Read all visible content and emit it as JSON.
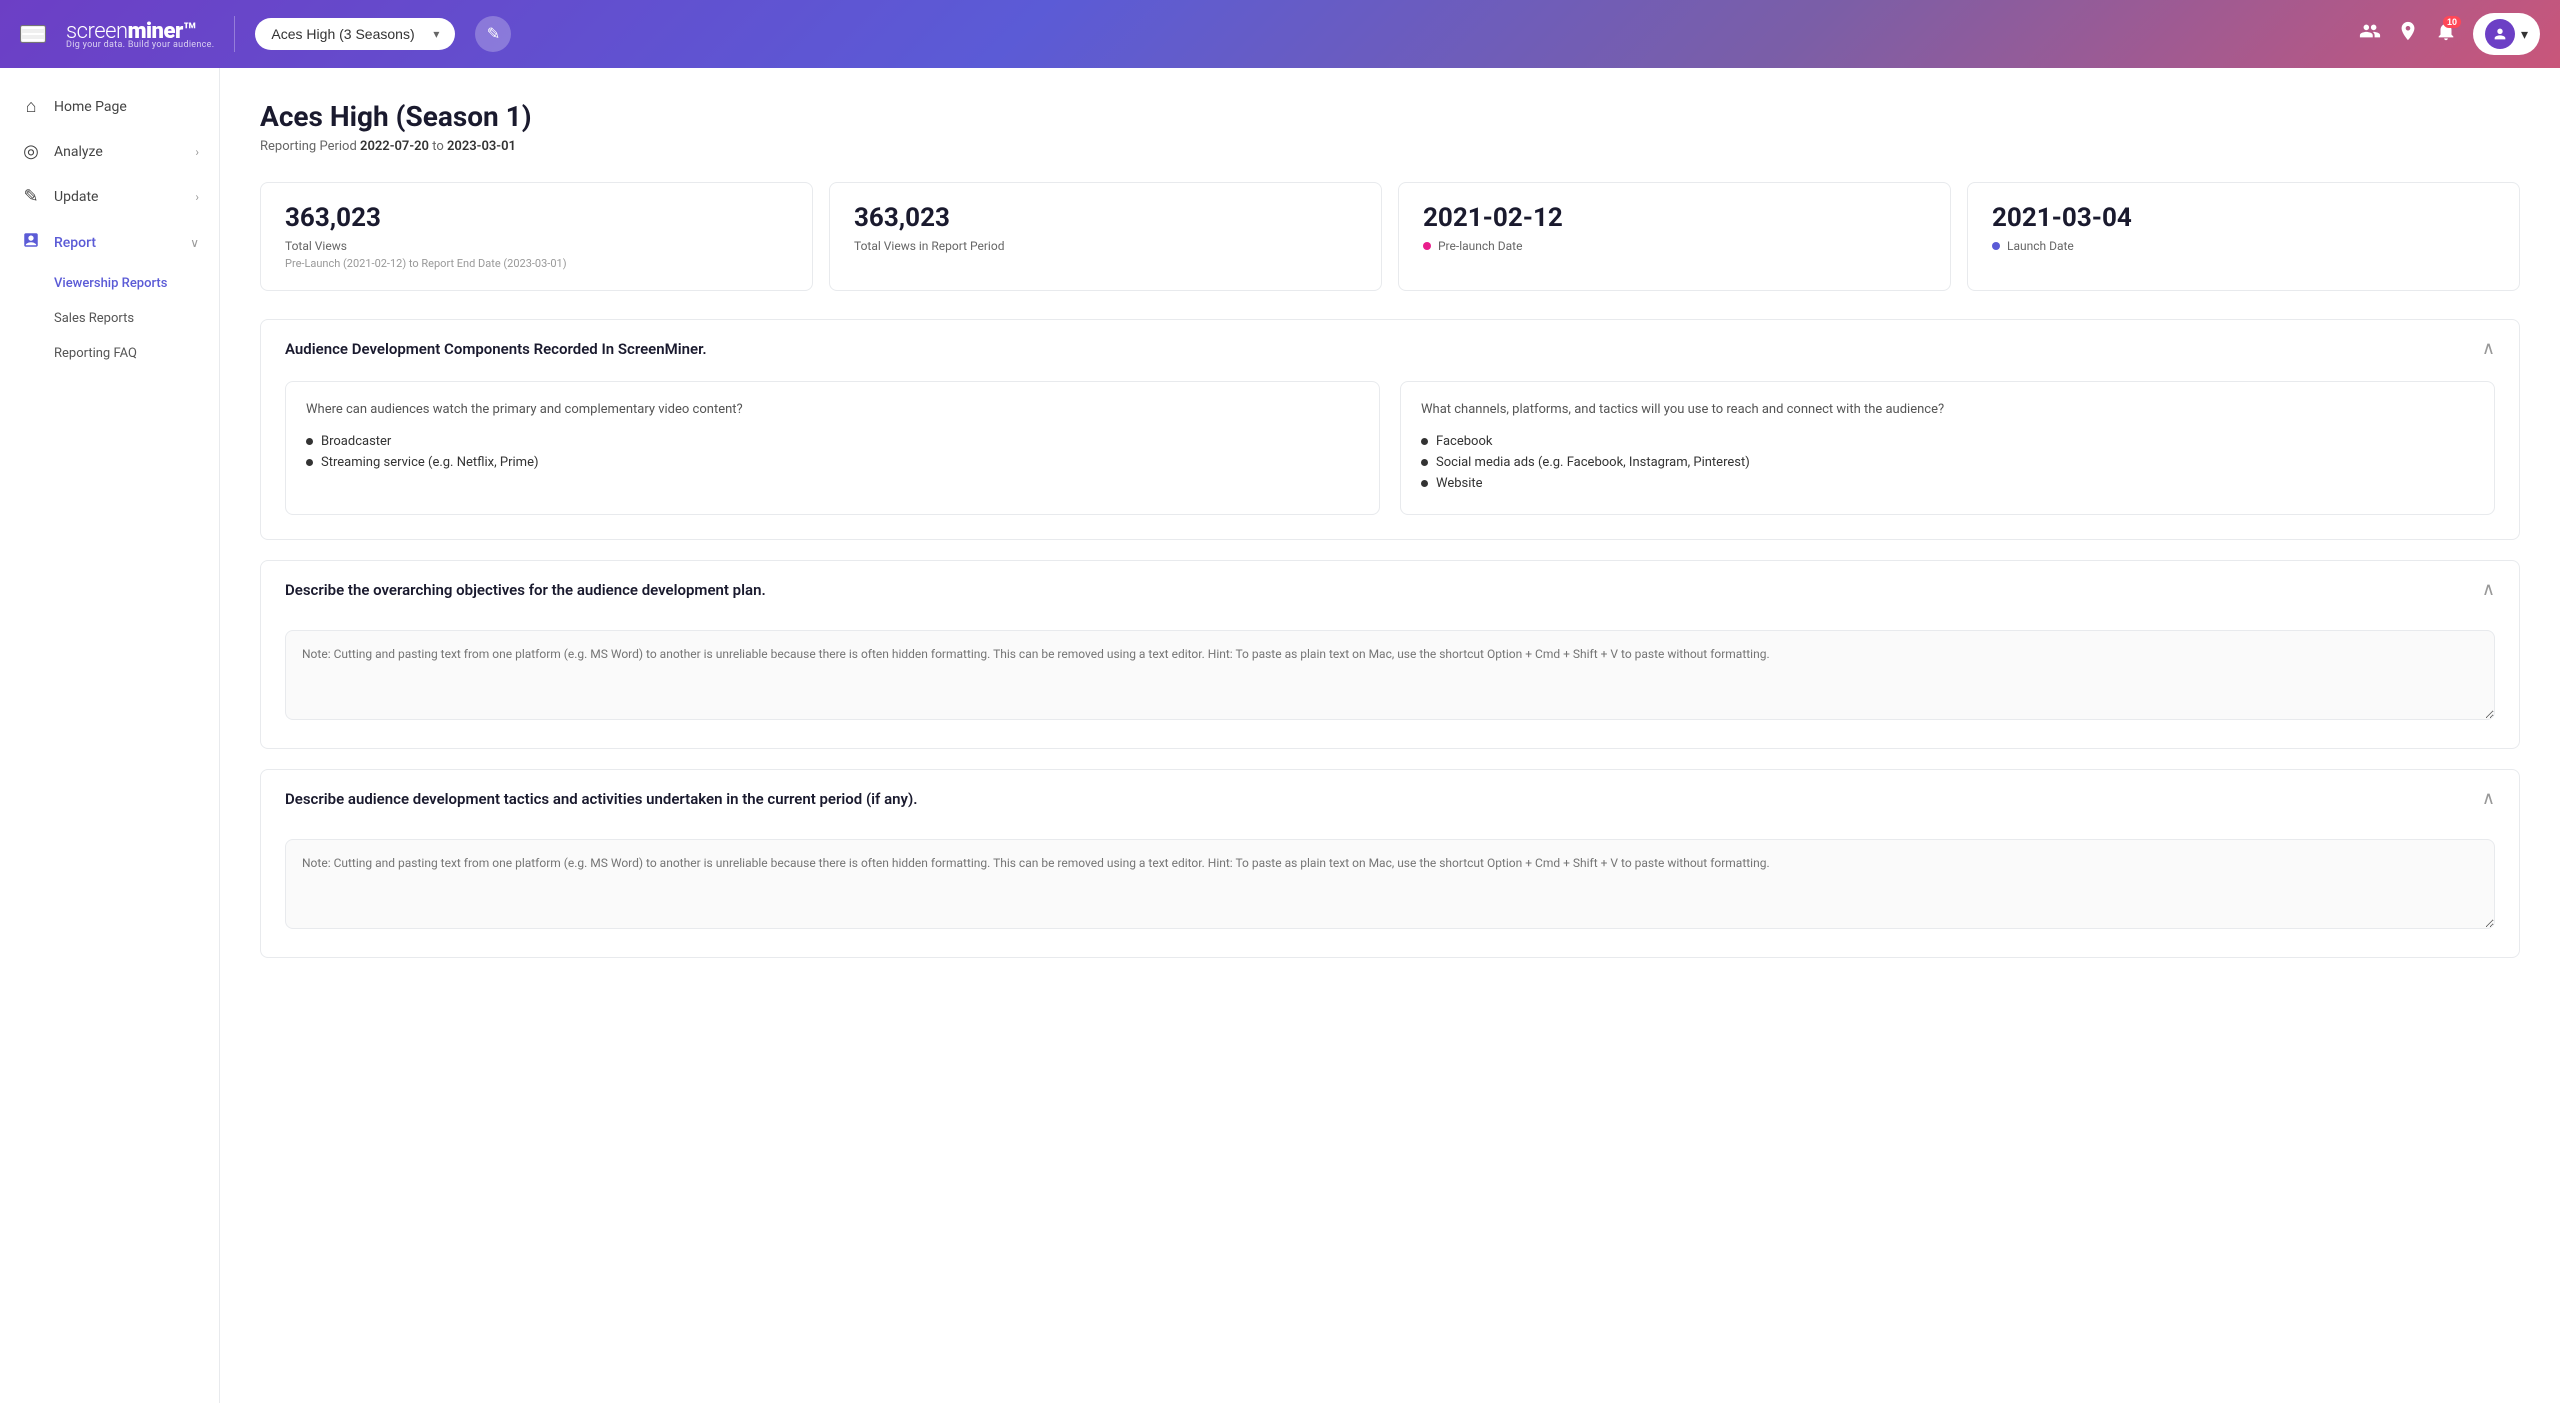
{
  "header": {
    "menu_label": "menu",
    "logo_main": "screen",
    "logo_bold": "miner",
    "logo_tagline": "Dig your data. Build your audience.",
    "show_selector_label": "Aces High (3 Seasons)",
    "edit_icon": "✎",
    "notifications_count": "10",
    "user_chevron": "▾"
  },
  "sidebar": {
    "items": [
      {
        "id": "home",
        "label": "Home Page",
        "icon": "⌂",
        "has_arrow": false,
        "active": false
      },
      {
        "id": "analyze",
        "label": "Analyze",
        "icon": "◎",
        "has_arrow": true,
        "active": false
      },
      {
        "id": "update",
        "label": "Update",
        "icon": "✎",
        "has_arrow": true,
        "active": false
      },
      {
        "id": "report",
        "label": "Report",
        "icon": "📋",
        "has_arrow": true,
        "active": true
      }
    ],
    "sub_items": [
      {
        "id": "viewership-reports",
        "label": "Viewership Reports",
        "active": true
      },
      {
        "id": "sales-reports",
        "label": "Sales Reports",
        "active": false
      },
      {
        "id": "reporting-faq",
        "label": "Reporting FAQ",
        "active": false
      }
    ]
  },
  "page": {
    "title": "Aces High (Season 1)",
    "reporting_period_label": "Reporting Period",
    "reporting_period_from": "2022-07-20",
    "reporting_period_to": "2023-03-01",
    "reporting_period_display": "Reporting Period 2022-07-20 to 2023-03-01"
  },
  "stats": [
    {
      "id": "total-views",
      "value": "363,023",
      "label": "Total Views",
      "sub": "Pre-Launch (2021-02-12) to Report End Date (2023-03-01)"
    },
    {
      "id": "total-views-period",
      "value": "363,023",
      "label": "Total Views in Report Period",
      "sub": ""
    },
    {
      "id": "pre-launch-date",
      "value": "2021-02-12",
      "label": "Pre-launch Date",
      "icon_color": "pink"
    },
    {
      "id": "launch-date",
      "value": "2021-03-04",
      "label": "Launch Date",
      "icon_color": "blue"
    }
  ],
  "sections": [
    {
      "id": "audience-development",
      "title": "Audience Development Components Recorded In ScreenMiner.",
      "collapsed": false,
      "two_col": true,
      "col1_question": "Where can audiences watch the primary and complementary video content?",
      "col1_items": [
        "Broadcaster",
        "Streaming service (e.g. Netflix, Prime)"
      ],
      "col2_question": "What channels, platforms, and tactics will you use to reach and connect with the audience?",
      "col2_items": [
        "Facebook",
        "Social media ads (e.g. Facebook, Instagram, Pinterest)",
        "Website"
      ]
    },
    {
      "id": "overarching-objectives",
      "title": "Describe the overarching objectives for the audience development plan.",
      "collapsed": false,
      "has_textarea": true,
      "textarea_placeholder": "Note: Cutting and pasting text from one platform (e.g. MS Word) to another is unreliable because there is often hidden formatting. This can be removed using a text editor. Hint: To paste as plain text on Mac, use the shortcut Option + Cmd + Shift + V to paste without formatting."
    },
    {
      "id": "audience-tactics",
      "title": "Describe audience development tactics and activities undertaken in the current period (if any).",
      "collapsed": false,
      "has_textarea": true,
      "textarea_placeholder": "Note: Cutting and pasting text from one platform (e.g. MS Word) to another is unreliable because there is often hidden formatting. This can be removed using a text editor. Hint: To paste as plain text on Mac, use the shortcut Option + Cmd + Shift + V to paste without formatting."
    }
  ]
}
